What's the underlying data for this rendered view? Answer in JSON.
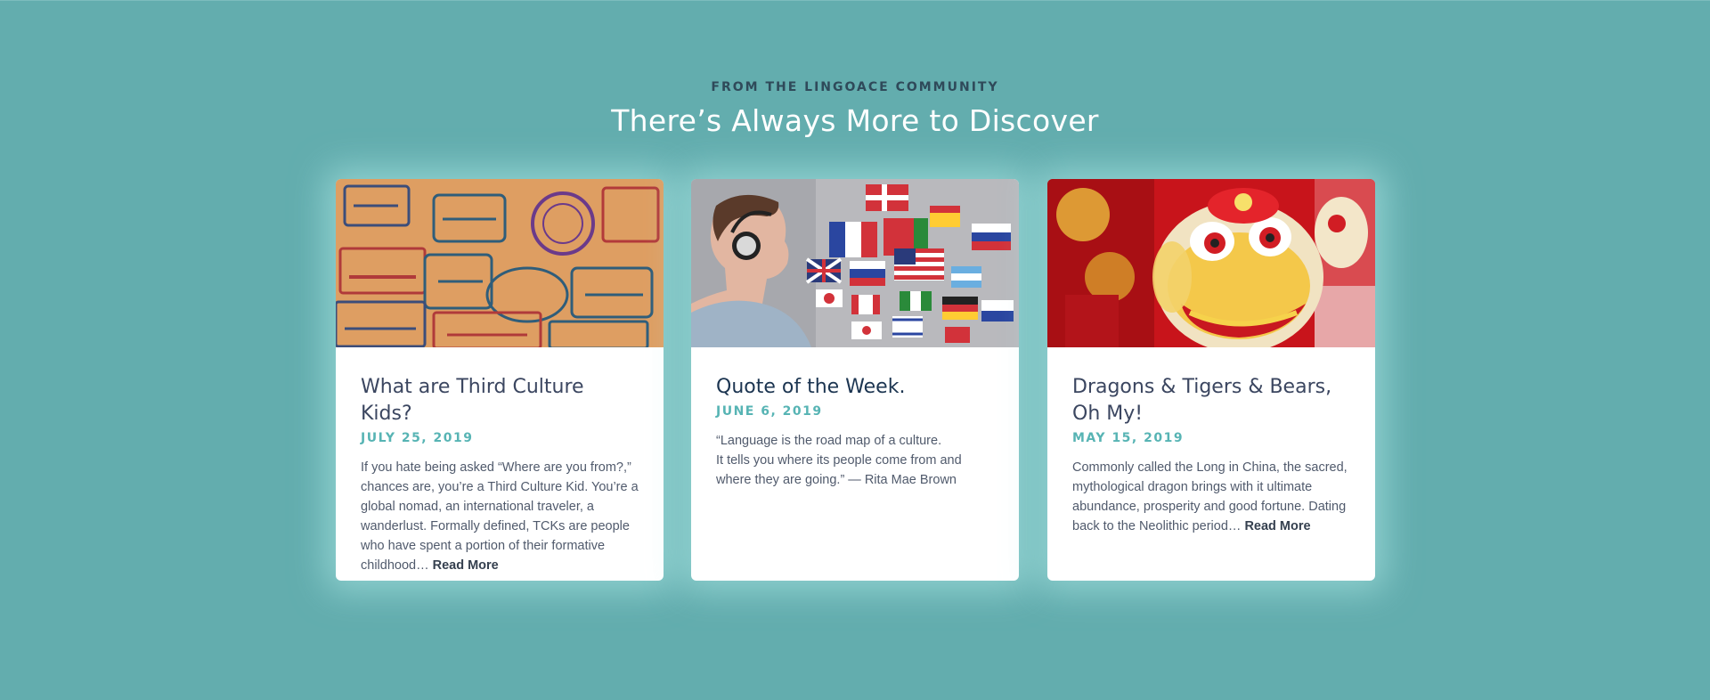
{
  "section": {
    "eyebrow": "FROM THE LINGOACE COMMUNITY",
    "headline": "There’s Always More to Discover"
  },
  "colors": {
    "background": "#63adae",
    "date_accent": "#57b4b4",
    "title": "#3b4660"
  },
  "cards": [
    {
      "image_desc": "passport-stamps-image",
      "title": "What are Third Culture Kids?",
      "date": "JULY 25, 2019",
      "excerpt": "If you hate being asked “Where are you from?,” chances are, you’re a Third Culture Kid. You’re a global nomad, an international traveler, a wanderlust. Formally defined, TCKs are people who have spent a portion of their formative childhood…",
      "read_more": "Read More"
    },
    {
      "image_desc": "boy-headphones-flags-image",
      "title": "Quote of the Week.",
      "date": "JUNE 6, 2019",
      "quote_line1": "“Language is the road map of a culture.",
      "quote_line2": "It tells you where its people come from and where they are going.”  —  Rita Mae Brown"
    },
    {
      "image_desc": "lion-dance-image",
      "title": "Dragons & Tigers & Bears, Oh My!",
      "date": "MAY 15, 2019",
      "excerpt": "Commonly called the Long in China, the sacred, mythological dragon brings with it ultimate abundance, prosperity and good fortune. Dating back to the Neolithic period…",
      "read_more": "Read More"
    }
  ]
}
